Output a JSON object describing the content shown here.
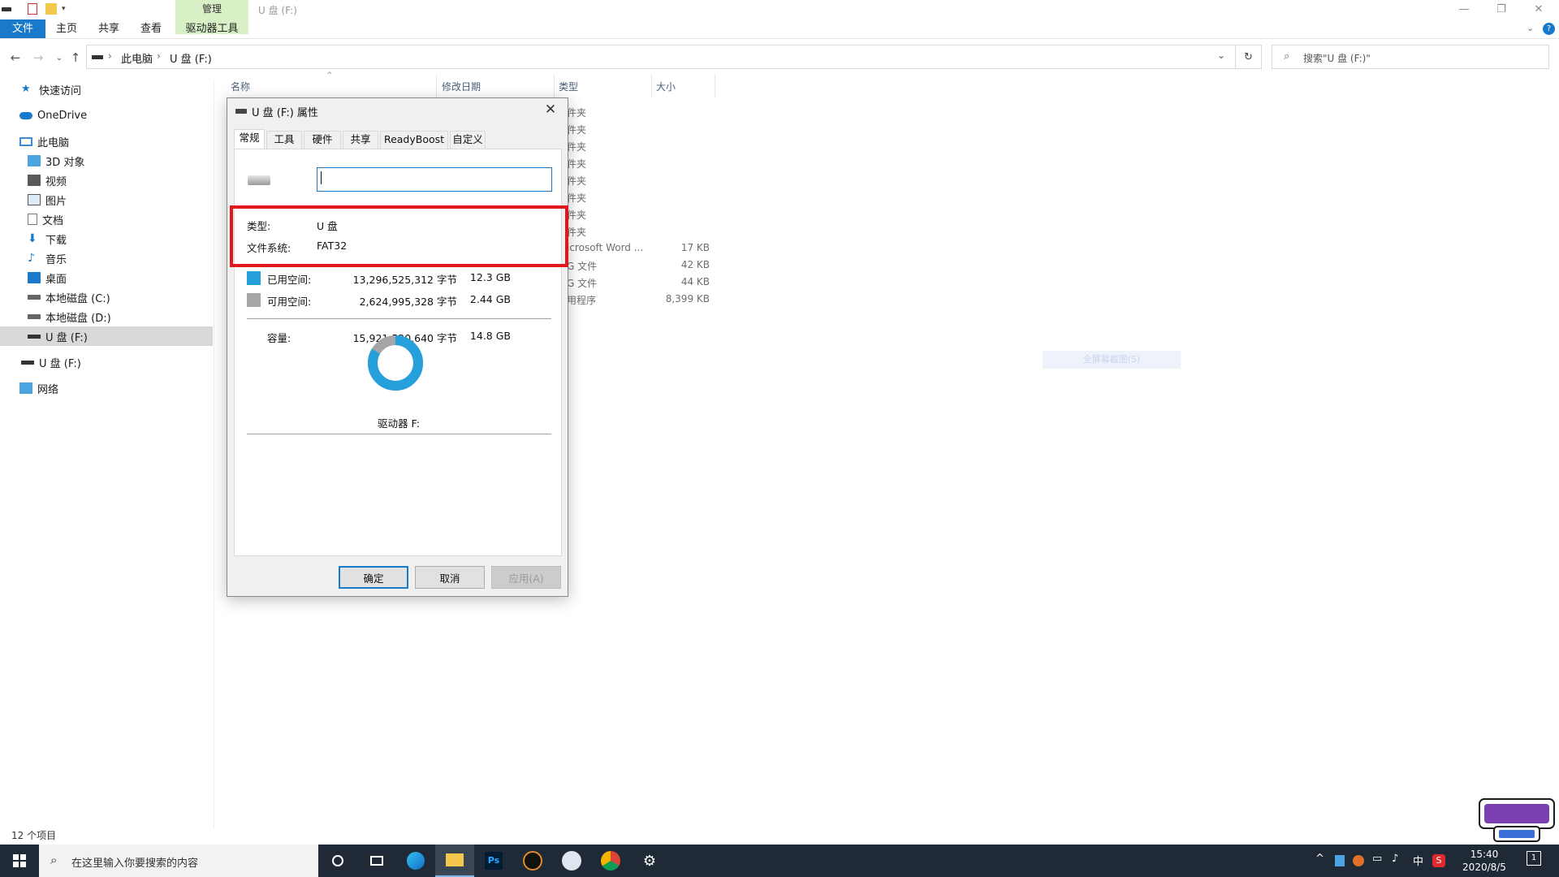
{
  "titlebar": {
    "manage_label": "管理",
    "window_title": "U 盘 (F:)",
    "minimize": "—",
    "restore": "❐",
    "close": "✕"
  },
  "ribbon": {
    "tabs": [
      "文件",
      "主页",
      "共享",
      "查看",
      "驱动器工具"
    ]
  },
  "address": {
    "crumbs": [
      "此电脑",
      "U 盘 (F:)"
    ],
    "search_placeholder": "搜索\"U 盘 (F:)\""
  },
  "sidebar": {
    "items": [
      {
        "label": "快速访问",
        "icon": "star-icon"
      },
      {
        "label": "OneDrive",
        "icon": "cloud-icon"
      },
      {
        "label": "此电脑",
        "icon": "computer-icon"
      },
      {
        "label": "3D 对象",
        "icon": "cube-icon"
      },
      {
        "label": "视频",
        "icon": "video-icon"
      },
      {
        "label": "图片",
        "icon": "picture-icon"
      },
      {
        "label": "文档",
        "icon": "document-icon"
      },
      {
        "label": "下载",
        "icon": "download-icon"
      },
      {
        "label": "音乐",
        "icon": "music-icon"
      },
      {
        "label": "桌面",
        "icon": "desktop-icon"
      },
      {
        "label": "本地磁盘 (C:)",
        "icon": "drive-icon"
      },
      {
        "label": "本地磁盘 (D:)",
        "icon": "drive-icon"
      },
      {
        "label": "U 盘 (F:)",
        "icon": "usb-drive-icon"
      },
      {
        "label": "U 盘 (F:)",
        "icon": "usb-drive-icon"
      },
      {
        "label": "网络",
        "icon": "network-icon"
      }
    ]
  },
  "filelist": {
    "columns": [
      "名称",
      "修改日期",
      "类型",
      "大小"
    ],
    "types": [
      "件夹",
      "件夹",
      "件夹",
      "件夹",
      "件夹",
      "件夹",
      "件夹",
      "件夹",
      "icrosoft Word ...",
      "G 文件",
      "G 文件",
      "用程序"
    ],
    "sizes": [
      "17 KB",
      "42 KB",
      "44 KB",
      "8,399 KB"
    ],
    "context_hint": "全屏幕截图(S)"
  },
  "status": {
    "count": "12 个项目"
  },
  "dialog": {
    "title": "U 盘 (F:) 属性",
    "tabs": [
      "常规",
      "工具",
      "硬件",
      "共享",
      "ReadyBoost",
      "自定义"
    ],
    "name_value": "",
    "type_label": "类型:",
    "type_value": "U 盘",
    "fs_label": "文件系统:",
    "fs_value": "FAT32",
    "used_label": "已用空间:",
    "used_bytes": "13,296,525,312 字节",
    "used_gb": "12.3 GB",
    "free_label": "可用空间:",
    "free_bytes": "2,624,995,328 字节",
    "free_gb": "2.44 GB",
    "capacity_label": "容量:",
    "capacity_bytes": "15,921,520,640 字节",
    "capacity_gb": "14.8 GB",
    "drive_label": "驱动器 F:",
    "used_fraction": 0.835,
    "used_color": "#26a0da",
    "free_color": "#a6a6a6",
    "buttons": {
      "ok": "确定",
      "cancel": "取消",
      "apply": "应用(A)"
    }
  },
  "taskbar": {
    "search_placeholder": "在这里输入你要搜索的内容",
    "time": "15:40",
    "date": "2020/8/5",
    "ime": "中",
    "notification_count": "1"
  }
}
